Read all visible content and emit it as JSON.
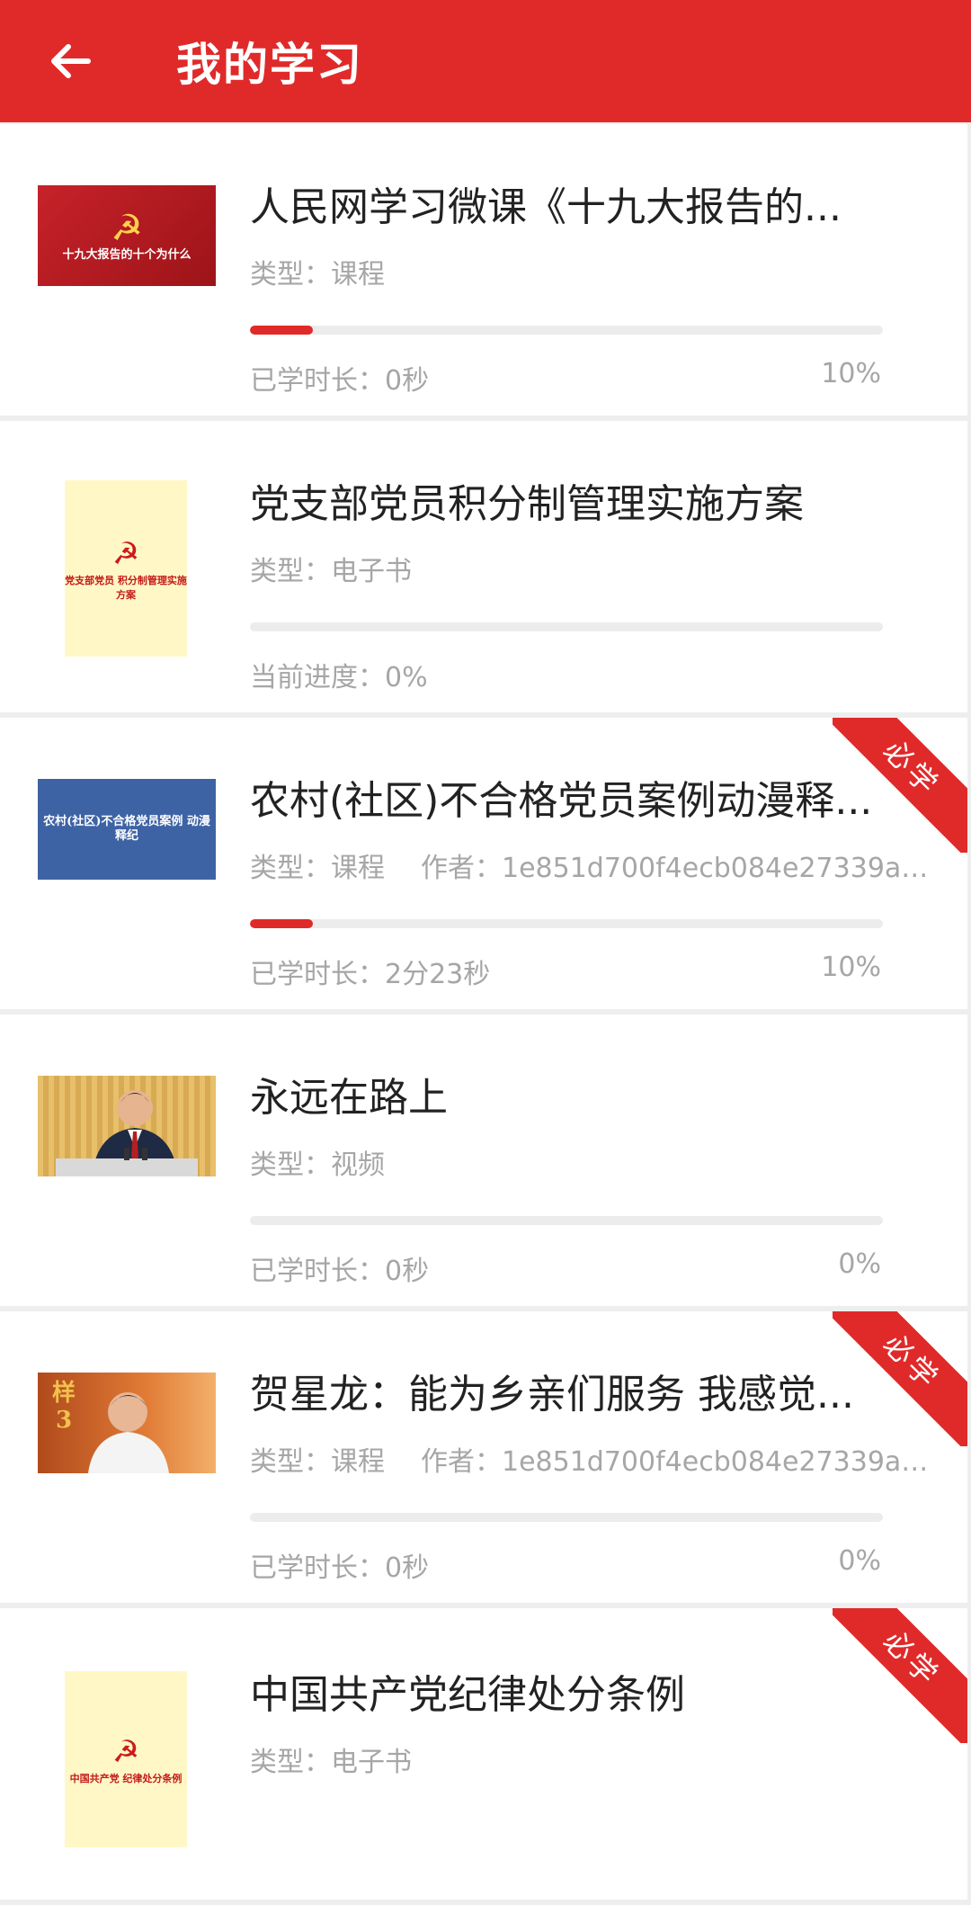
{
  "header": {
    "title": "我的学习"
  },
  "items": [
    {
      "title": "人民网学习微课《十九大报告的...",
      "type": "类型：课程",
      "author": "",
      "progress": 0.1,
      "foot_left": "已学时长：0秒",
      "foot_right": "10%",
      "required": false,
      "thumb_caption": "十九大报告的十个为什么"
    },
    {
      "title": "党支部党员积分制管理实施方案",
      "type": "类型：电子书",
      "author": "",
      "progress": 0,
      "foot_left": "当前进度：0%",
      "foot_right": "",
      "required": false,
      "thumb_caption": "党支部党员 积分制管理实施方案"
    },
    {
      "title": "农村(社区)不合格党员案例动漫释...",
      "type": "类型：课程",
      "author": "作者：1e851d700f4ecb084e27339a5...",
      "progress": 0.1,
      "foot_left": "已学时长：2分23秒",
      "foot_right": "10%",
      "required": true,
      "thumb_caption": "农村(社区)不合格党员案例 动漫释纪"
    },
    {
      "title": "永远在路上",
      "type": "类型：视频",
      "author": "",
      "progress": 0,
      "foot_left": "已学时长：0秒",
      "foot_right": "0%",
      "required": false,
      "thumb_caption": ""
    },
    {
      "title": "贺星龙：能为乡亲们服务 我感觉...",
      "type": "类型：课程",
      "author": "作者：1e851d700f4ecb084e27339a5...",
      "progress": 0,
      "foot_left": "已学时长：0秒",
      "foot_right": "0%",
      "required": true,
      "thumb_caption": "样 3"
    },
    {
      "title": "中国共产党纪律处分条例",
      "type": "类型：电子书",
      "author": "",
      "progress": 0,
      "foot_left": "",
      "foot_right": "",
      "required": true,
      "thumb_caption": "中国共产党 纪律处分条例"
    }
  ],
  "badge_label": "必学",
  "colors": {
    "accent": "#e02a2a"
  }
}
